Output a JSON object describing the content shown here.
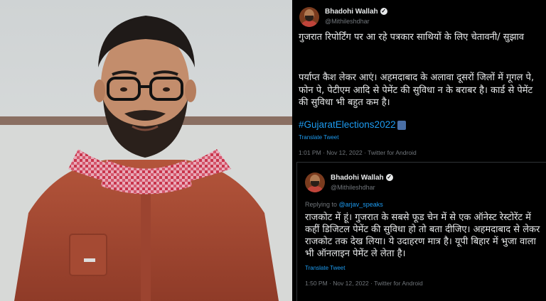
{
  "tweet1": {
    "author_name": "Bhadohi Wallah",
    "handle": "@Mithileshdhar",
    "line1": "गुजरात रिपोर्टिंग पर आ रहे पत्रकार साथियों के लिए चेतावनी/ सुझाव",
    "body": "पर्याप्त कैश लेकर आएं। अहमदाबाद के अलावा दूसरों जिलों में गूगल पे, फोन पे, पेटीएम आदि से पेमेंट की सुविधा न के बराबर है। कार्ड से पेमेंट की सुविधा भी बहुत कम है।",
    "hashtag": "#GujaratElections2022",
    "translate": "Translate Tweet",
    "meta": "1:01 PM · Nov 12, 2022 · Twitter for Android"
  },
  "tweet2": {
    "author_name": "Bhadohi Wallah",
    "handle": "@Mithileshdhar",
    "replying_prefix": "Replying to",
    "replying_to": "@arjav_speaks",
    "body": "राजकोट में हूं। गुजरात के सबसे फूड चेन में से एक ऑनेस्ट रेस्टोरेंट में कहीं डिजिटल पेमेंट की सुविधा हो तो बता दीजिए। अहमदाबाद से लेकर राजकोट तक देख लिया। ये उदाहरण मात्र है। यूपी बिहार में भुजा वाला भी ऑनलाइन पेमेंट ले लेता है।",
    "translate": "Translate Tweet",
    "meta": "1:50 PM · Nov 12, 2022 · Twitter for Android"
  },
  "icons": {
    "verified": "verified-badge-icon",
    "flag": "flag-emoji-icon"
  },
  "colors": {
    "background": "#000000",
    "text": "#e7e9ea",
    "muted": "#71767b",
    "link": "#1d9bf0"
  }
}
